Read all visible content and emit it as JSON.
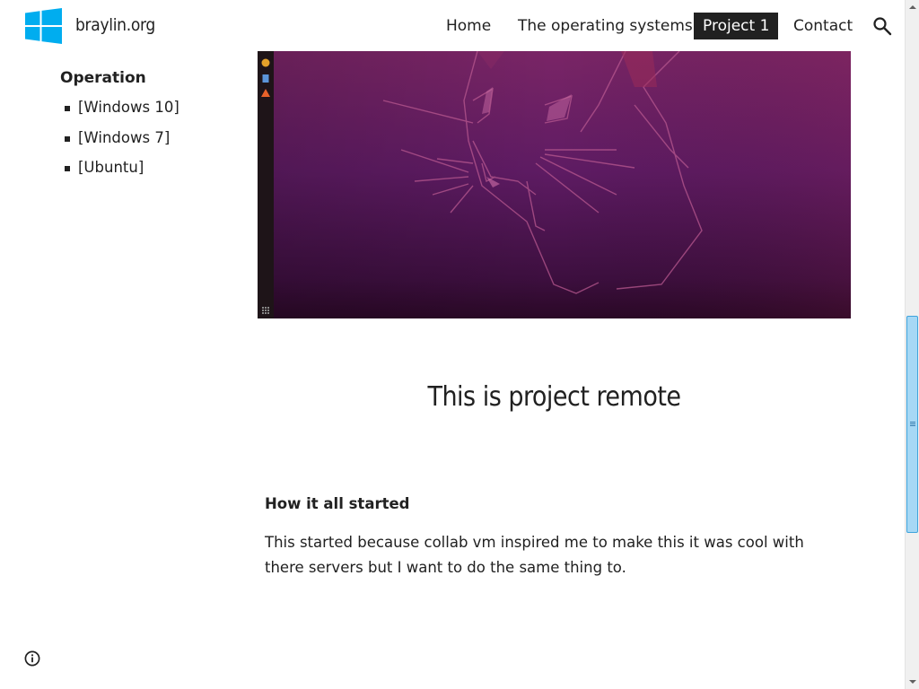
{
  "site": {
    "title": "braylin.org"
  },
  "nav": {
    "items": [
      {
        "label": "Home",
        "active": false
      },
      {
        "label": "The operating systems",
        "active": false
      },
      {
        "label": "Project 1",
        "active": true
      },
      {
        "label": "Contact",
        "active": false
      }
    ],
    "search_icon": "search-icon"
  },
  "sidebar": {
    "heading": "Operation",
    "items": [
      {
        "label": "[Windows 10]"
      },
      {
        "label": "[Windows 7]"
      },
      {
        "label": "[Ubuntu]"
      }
    ]
  },
  "main": {
    "hero_image": "ubuntu-desktop-wallpaper",
    "title": "This is project remote",
    "section_heading": "How it all started",
    "section_body": "This started because collab vm inspired me to make this it was cool with there servers but I want to do the same thing to."
  },
  "footer": {
    "info_icon": "info-icon"
  },
  "colors": {
    "brand_logo": "#00adef",
    "text": "#212121",
    "active_nav_bg": "#212121",
    "hero_purple": "#6b1f5f",
    "scroll_thumb": "#a6d8f5"
  }
}
